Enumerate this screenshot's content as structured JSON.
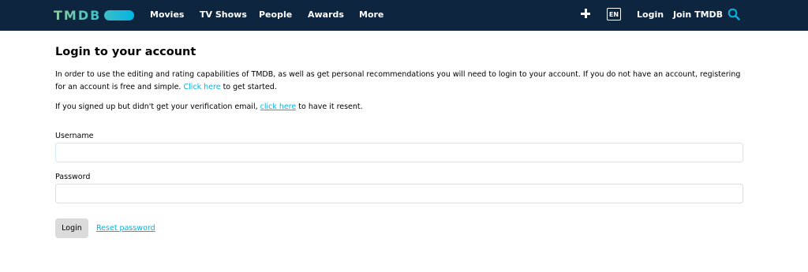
{
  "header": {
    "logo_text": "TMDB",
    "nav": [
      "Movies",
      "TV Shows",
      "People",
      "Awards",
      "More"
    ],
    "add_icon": "plus-icon",
    "language": "EN",
    "login": "Login",
    "join": "Join TMDB",
    "search_icon": "search-icon",
    "colors": {
      "background": "#0d253f",
      "accent": "#01b4e4",
      "logo": "#90cea1"
    }
  },
  "main": {
    "title": "Login to your account",
    "intro_text": "In order to use the editing and rating capabilities of TMDB, as well as get personal recommendations you will need to login to your account. If you do not have an account, registering for an account is free and simple. ",
    "intro_link": "Click here",
    "intro_after": " to get started.",
    "verify_text": "If you signed up but didn't get your verification email, ",
    "verify_link": "click here",
    "verify_after": " to have it resent.",
    "username_label": "Username",
    "username_value": "",
    "password_label": "Password",
    "password_value": "",
    "login_button": "Login",
    "reset_link": "Reset password"
  }
}
